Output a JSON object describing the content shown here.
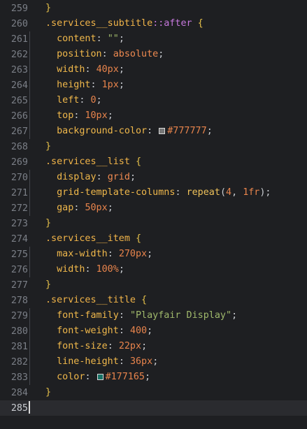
{
  "editor": {
    "lines": [
      {
        "num": "259",
        "indent": 0,
        "tokens": [
          {
            "t": "}",
            "c": "t-brace"
          }
        ]
      },
      {
        "num": "260",
        "indent": 0,
        "tokens": [
          {
            "t": ".services__subtitle",
            "c": "t-sel"
          },
          {
            "t": "::after",
            "c": "t-pseudo"
          },
          {
            "t": " {",
            "c": "t-brace"
          }
        ]
      },
      {
        "num": "261",
        "indent": 1,
        "tokens": [
          {
            "t": "content",
            "c": "t-prop"
          },
          {
            "t": ": ",
            "c": "t-punc"
          },
          {
            "t": "\"\"",
            "c": "t-str"
          },
          {
            "t": ";",
            "c": "t-punc"
          }
        ]
      },
      {
        "num": "262",
        "indent": 1,
        "tokens": [
          {
            "t": "position",
            "c": "t-prop"
          },
          {
            "t": ": ",
            "c": "t-punc"
          },
          {
            "t": "absolute",
            "c": "t-kw"
          },
          {
            "t": ";",
            "c": "t-punc"
          }
        ]
      },
      {
        "num": "263",
        "indent": 1,
        "tokens": [
          {
            "t": "width",
            "c": "t-prop"
          },
          {
            "t": ": ",
            "c": "t-punc"
          },
          {
            "t": "40px",
            "c": "t-num"
          },
          {
            "t": ";",
            "c": "t-punc"
          }
        ]
      },
      {
        "num": "264",
        "indent": 1,
        "tokens": [
          {
            "t": "height",
            "c": "t-prop"
          },
          {
            "t": ": ",
            "c": "t-punc"
          },
          {
            "t": "1px",
            "c": "t-num"
          },
          {
            "t": ";",
            "c": "t-punc"
          }
        ]
      },
      {
        "num": "265",
        "indent": 1,
        "tokens": [
          {
            "t": "left",
            "c": "t-prop"
          },
          {
            "t": ": ",
            "c": "t-punc"
          },
          {
            "t": "0",
            "c": "t-num"
          },
          {
            "t": ";",
            "c": "t-punc"
          }
        ]
      },
      {
        "num": "266",
        "indent": 1,
        "tokens": [
          {
            "t": "top",
            "c": "t-prop"
          },
          {
            "t": ": ",
            "c": "t-punc"
          },
          {
            "t": "10px",
            "c": "t-num"
          },
          {
            "t": ";",
            "c": "t-punc"
          }
        ]
      },
      {
        "num": "267",
        "indent": 1,
        "tokens": [
          {
            "t": "background-color",
            "c": "t-prop"
          },
          {
            "t": ": ",
            "c": "t-punc"
          },
          {
            "swatch": "#777777"
          },
          {
            "t": "#777777",
            "c": "t-num"
          },
          {
            "t": ";",
            "c": "t-punc"
          }
        ]
      },
      {
        "num": "268",
        "indent": 0,
        "tokens": [
          {
            "t": "}",
            "c": "t-brace"
          }
        ]
      },
      {
        "num": "269",
        "indent": 0,
        "tokens": [
          {
            "t": ".services__list",
            "c": "t-sel"
          },
          {
            "t": " {",
            "c": "t-brace"
          }
        ]
      },
      {
        "num": "270",
        "indent": 1,
        "tokens": [
          {
            "t": "display",
            "c": "t-prop"
          },
          {
            "t": ": ",
            "c": "t-punc"
          },
          {
            "t": "grid",
            "c": "t-kw"
          },
          {
            "t": ";",
            "c": "t-punc"
          }
        ]
      },
      {
        "num": "271",
        "indent": 1,
        "tokens": [
          {
            "t": "grid-template-columns",
            "c": "t-prop"
          },
          {
            "t": ": ",
            "c": "t-punc"
          },
          {
            "t": "repeat",
            "c": "t-func"
          },
          {
            "t": "(",
            "c": "t-punc"
          },
          {
            "t": "4",
            "c": "t-num"
          },
          {
            "t": ", ",
            "c": "t-punc"
          },
          {
            "t": "1fr",
            "c": "t-num"
          },
          {
            "t": ");",
            "c": "t-punc"
          }
        ]
      },
      {
        "num": "272",
        "indent": 1,
        "tokens": [
          {
            "t": "gap",
            "c": "t-prop"
          },
          {
            "t": ": ",
            "c": "t-punc"
          },
          {
            "t": "50px",
            "c": "t-num"
          },
          {
            "t": ";",
            "c": "t-punc"
          }
        ]
      },
      {
        "num": "273",
        "indent": 0,
        "tokens": [
          {
            "t": "}",
            "c": "t-brace"
          }
        ]
      },
      {
        "num": "274",
        "indent": 0,
        "tokens": [
          {
            "t": ".services__item",
            "c": "t-sel"
          },
          {
            "t": " {",
            "c": "t-brace"
          }
        ]
      },
      {
        "num": "275",
        "indent": 1,
        "tokens": [
          {
            "t": "max-width",
            "c": "t-prop"
          },
          {
            "t": ": ",
            "c": "t-punc"
          },
          {
            "t": "270px",
            "c": "t-num"
          },
          {
            "t": ";",
            "c": "t-punc"
          }
        ]
      },
      {
        "num": "276",
        "indent": 1,
        "tokens": [
          {
            "t": "width",
            "c": "t-prop"
          },
          {
            "t": ": ",
            "c": "t-punc"
          },
          {
            "t": "100%",
            "c": "t-num"
          },
          {
            "t": ";",
            "c": "t-punc"
          }
        ]
      },
      {
        "num": "277",
        "indent": 0,
        "tokens": [
          {
            "t": "}",
            "c": "t-brace"
          }
        ]
      },
      {
        "num": "278",
        "indent": 0,
        "tokens": [
          {
            "t": ".services__title",
            "c": "t-sel"
          },
          {
            "t": " {",
            "c": "t-brace"
          }
        ]
      },
      {
        "num": "279",
        "indent": 1,
        "tokens": [
          {
            "t": "font-family",
            "c": "t-prop"
          },
          {
            "t": ": ",
            "c": "t-punc"
          },
          {
            "t": "\"Playfair Display\"",
            "c": "t-str"
          },
          {
            "t": ";",
            "c": "t-punc"
          }
        ]
      },
      {
        "num": "280",
        "indent": 1,
        "tokens": [
          {
            "t": "font-weight",
            "c": "t-prop"
          },
          {
            "t": ": ",
            "c": "t-punc"
          },
          {
            "t": "400",
            "c": "t-num"
          },
          {
            "t": ";",
            "c": "t-punc"
          }
        ]
      },
      {
        "num": "281",
        "indent": 1,
        "tokens": [
          {
            "t": "font-size",
            "c": "t-prop"
          },
          {
            "t": ": ",
            "c": "t-punc"
          },
          {
            "t": "22px",
            "c": "t-num"
          },
          {
            "t": ";",
            "c": "t-punc"
          }
        ]
      },
      {
        "num": "282",
        "indent": 1,
        "tokens": [
          {
            "t": "line-height",
            "c": "t-prop"
          },
          {
            "t": ": ",
            "c": "t-punc"
          },
          {
            "t": "36px",
            "c": "t-num"
          },
          {
            "t": ";",
            "c": "t-punc"
          }
        ]
      },
      {
        "num": "283",
        "indent": 1,
        "tokens": [
          {
            "t": "color",
            "c": "t-prop"
          },
          {
            "t": ": ",
            "c": "t-punc"
          },
          {
            "swatch": "#177165"
          },
          {
            "t": "#177165",
            "c": "t-num"
          },
          {
            "t": ";",
            "c": "t-punc"
          }
        ]
      },
      {
        "num": "284",
        "indent": 0,
        "tokens": [
          {
            "t": "}",
            "c": "t-brace"
          }
        ]
      },
      {
        "num": "285",
        "indent": 0,
        "active": true,
        "tokens": []
      }
    ]
  }
}
